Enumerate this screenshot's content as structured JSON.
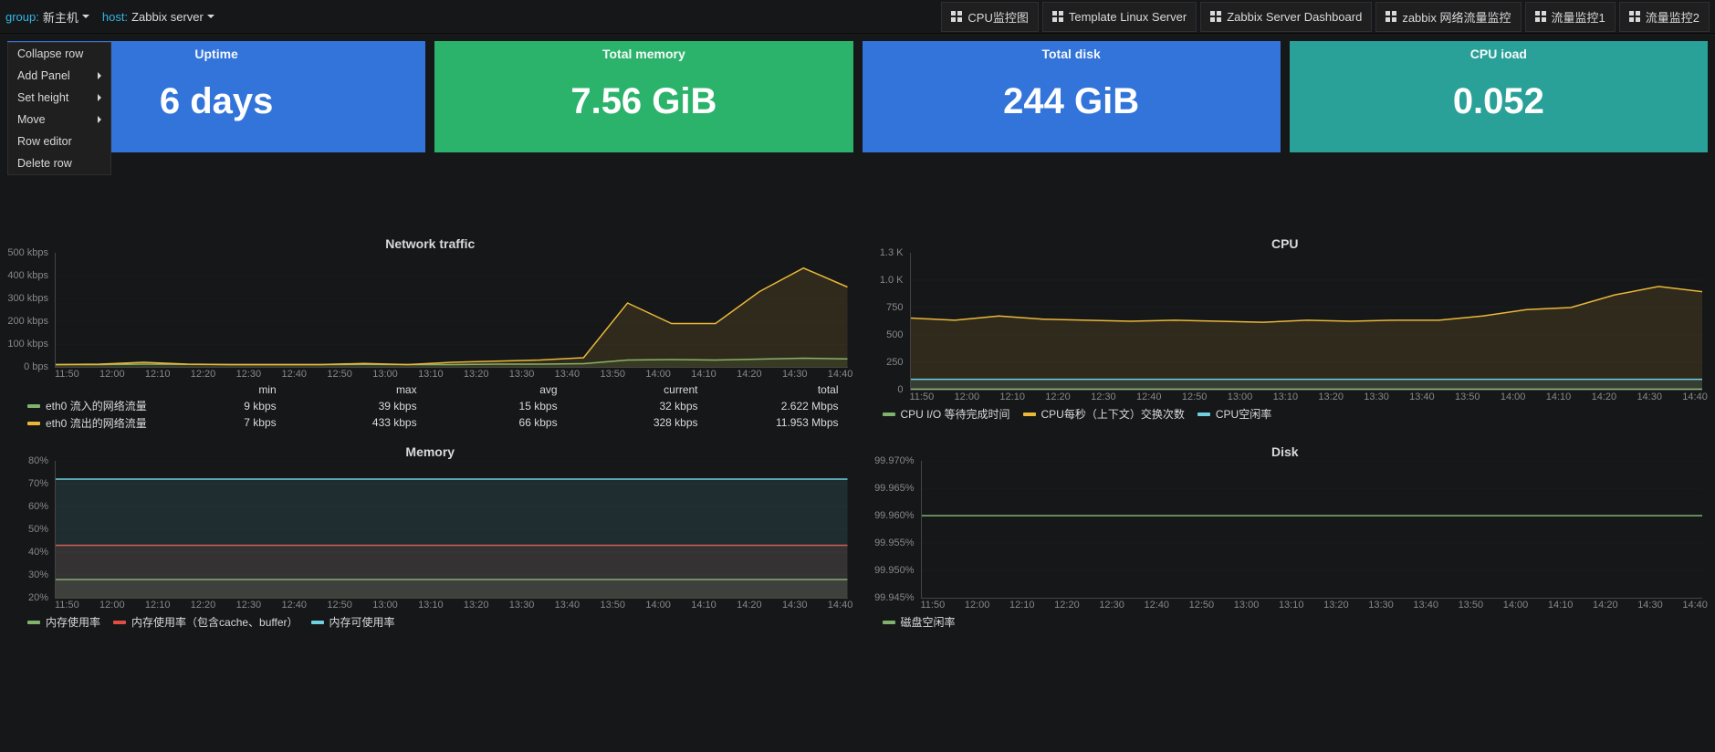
{
  "templating": {
    "group_label": "group:",
    "group_value": "新主机",
    "host_label": "host:",
    "host_value": "Zabbix server"
  },
  "dash_links": [
    "CPU监控图",
    "Template Linux Server",
    "Zabbix Server Dashboard",
    "zabbix 网络流量监控",
    "流量监控1",
    "流量监控2"
  ],
  "row_menu": {
    "collapse": "Collapse row",
    "add": "Add Panel",
    "height": "Set height",
    "move": "Move",
    "editor": "Row editor",
    "delete": "Delete row"
  },
  "stats": {
    "uptime": {
      "title": "Uptime",
      "value": "6 days"
    },
    "memory": {
      "title": "Total memory",
      "value": "7.56 GiB"
    },
    "disk": {
      "title": "Total disk",
      "value": "244 GiB"
    },
    "cpuload": {
      "title": "CPU ioad",
      "value": "0.052"
    }
  },
  "panels": {
    "network": {
      "title": "Network traffic",
      "y_labels": [
        "500 kbps",
        "400 kbps",
        "300 kbps",
        "200 kbps",
        "100 kbps",
        "0 bps"
      ],
      "legend_headers": [
        "min",
        "max",
        "avg",
        "current",
        "total"
      ],
      "series": [
        {
          "name": "eth0 流入的网络流量",
          "color": "c-green",
          "vals": [
            "9 kbps",
            "39 kbps",
            "15 kbps",
            "32 kbps",
            "2.622 Mbps"
          ]
        },
        {
          "name": "eth0 流出的网络流量",
          "color": "c-yellow",
          "vals": [
            "7 kbps",
            "433 kbps",
            "66 kbps",
            "328 kbps",
            "11.953 Mbps"
          ]
        }
      ]
    },
    "cpu": {
      "title": "CPU",
      "y_labels": [
        "1.3 K",
        "1.0 K",
        "750",
        "500",
        "250",
        "0"
      ],
      "series": [
        {
          "name": "CPU I/O 等待完成时间",
          "color": "c-green"
        },
        {
          "name": "CPU每秒（上下文）交换次数",
          "color": "c-yellow"
        },
        {
          "name": "CPU空闲率",
          "color": "c-cyan"
        }
      ]
    },
    "memory": {
      "title": "Memory",
      "y_labels": [
        "80%",
        "70%",
        "60%",
        "50%",
        "40%",
        "30%",
        "20%"
      ],
      "series": [
        {
          "name": "内存使用率",
          "color": "c-green"
        },
        {
          "name": "内存使用率（包含cache、buffer）",
          "color": "c-red"
        },
        {
          "name": "内存可使用率",
          "color": "c-cyan"
        }
      ]
    },
    "disk": {
      "title": "Disk",
      "y_labels": [
        "99.970%",
        "99.965%",
        "99.960%",
        "99.955%",
        "99.950%",
        "99.945%"
      ],
      "series": [
        {
          "name": "磁盘空闲率",
          "color": "c-green"
        }
      ]
    }
  },
  "x_ticks_short": [
    "11:50",
    "12:00",
    "12:10",
    "12:20",
    "12:30",
    "12:40",
    "12:50",
    "13:00",
    "13:10",
    "13:20",
    "13:30",
    "13:40",
    "13:50",
    "14:00",
    "14:10",
    "14:20",
    "14:30",
    "14:40"
  ],
  "chart_data": [
    {
      "id": "network",
      "type": "line",
      "xlabel": "",
      "ylabel": "bps",
      "ylim": [
        0,
        500000
      ],
      "x": [
        "11:50",
        "12:00",
        "12:10",
        "12:20",
        "12:30",
        "12:40",
        "12:50",
        "13:00",
        "13:10",
        "13:20",
        "13:30",
        "13:40",
        "13:50",
        "14:00",
        "14:10",
        "14:20",
        "14:30",
        "14:40",
        "14:47"
      ],
      "series": [
        {
          "name": "eth0 流入的网络流量",
          "values": [
            10000,
            10000,
            12000,
            11000,
            10000,
            10000,
            10000,
            11000,
            10000,
            10000,
            12000,
            12000,
            14000,
            30000,
            32000,
            30000,
            34000,
            38000,
            35000
          ]
        },
        {
          "name": "eth0 流出的网络流量",
          "values": [
            10000,
            12000,
            20000,
            12000,
            10000,
            10000,
            10000,
            15000,
            10000,
            20000,
            25000,
            30000,
            40000,
            280000,
            190000,
            190000,
            330000,
            433000,
            350000
          ]
        }
      ]
    },
    {
      "id": "cpu",
      "type": "line",
      "xlabel": "",
      "ylabel": "",
      "ylim": [
        0,
        1300
      ],
      "x": [
        "11:50",
        "12:00",
        "12:10",
        "12:20",
        "12:30",
        "12:40",
        "12:50",
        "13:00",
        "13:10",
        "13:20",
        "13:30",
        "13:40",
        "13:50",
        "14:00",
        "14:10",
        "14:20",
        "14:30",
        "14:40",
        "14:47"
      ],
      "series": [
        {
          "name": "CPU I/O 等待完成时间",
          "values": [
            5,
            5,
            5,
            5,
            5,
            5,
            5,
            5,
            5,
            5,
            5,
            5,
            5,
            5,
            5,
            5,
            5,
            5,
            5
          ]
        },
        {
          "name": "CPU每秒（上下文）交换次数",
          "values": [
            680,
            660,
            700,
            670,
            660,
            650,
            660,
            650,
            640,
            660,
            650,
            660,
            660,
            700,
            760,
            780,
            900,
            980,
            930
          ]
        },
        {
          "name": "CPU空闲率",
          "values": [
            99,
            99,
            99,
            99,
            99,
            99,
            99,
            99,
            99,
            99,
            99,
            99,
            99,
            99,
            99,
            99,
            99,
            99,
            99
          ]
        }
      ]
    },
    {
      "id": "memory",
      "type": "line",
      "xlabel": "",
      "ylabel": "%",
      "ylim": [
        20,
        80
      ],
      "x": [
        "11:50",
        "12:00",
        "12:10",
        "12:20",
        "12:30",
        "12:40",
        "12:50",
        "13:00",
        "13:10",
        "13:20",
        "13:30",
        "13:40",
        "13:50",
        "14:00",
        "14:10",
        "14:20",
        "14:30",
        "14:40",
        "14:47"
      ],
      "series": [
        {
          "name": "内存使用率",
          "values": [
            28,
            28,
            28,
            28,
            28,
            28,
            28,
            28,
            28,
            28,
            28,
            28,
            28,
            28,
            28,
            28,
            28,
            28,
            28
          ]
        },
        {
          "name": "内存使用率（包含cache、buffer）",
          "values": [
            43,
            43,
            43,
            43,
            43,
            43,
            43,
            43,
            43,
            43,
            43,
            43,
            43,
            43,
            43,
            43,
            43,
            43,
            43
          ]
        },
        {
          "name": "内存可使用率",
          "values": [
            72,
            72,
            72,
            72,
            72,
            72,
            72,
            72,
            72,
            72,
            72,
            72,
            72,
            72,
            72,
            72,
            72,
            72,
            72
          ]
        }
      ]
    },
    {
      "id": "disk",
      "type": "line",
      "xlabel": "",
      "ylabel": "%",
      "ylim": [
        99.945,
        99.97
      ],
      "x": [
        "11:50",
        "12:00",
        "12:10",
        "12:20",
        "12:30",
        "12:40",
        "12:50",
        "13:00",
        "13:10",
        "13:20",
        "13:30",
        "13:40",
        "13:50",
        "14:00",
        "14:10",
        "14:20",
        "14:30",
        "14:40",
        "14:47"
      ],
      "series": [
        {
          "name": "磁盘空闲率",
          "values": [
            99.96,
            99.96,
            99.96,
            99.96,
            99.96,
            99.96,
            99.96,
            99.96,
            99.96,
            99.96,
            99.96,
            99.96,
            99.96,
            99.96,
            99.96,
            99.96,
            99.96,
            99.96,
            99.96
          ]
        }
      ]
    }
  ]
}
